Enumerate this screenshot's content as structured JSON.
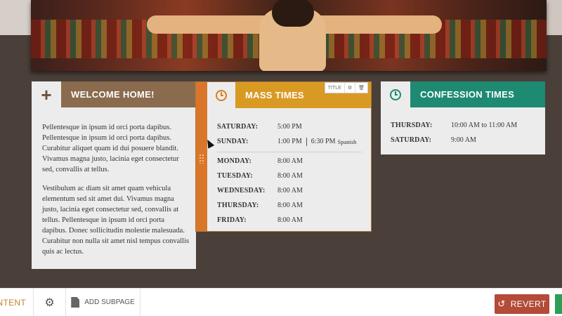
{
  "welcome": {
    "title": "WELCOME HOME!",
    "paragraphs": [
      "Pellentesque in ipsum id orci porta dapibus. Pellentesque in ipsum id orci porta dapibus. Curabitur aliquet quam id dui posuere blandit. Vivamus magna justo, lacinia eget consectetur sed, convallis at tellus.",
      "Vestibulum ac diam sit amet quam vehicula elementum sed sit amet dui. Vivamus magna justo, lacinia eget consectetur sed, convallis at tellus. Pellentesque in ipsum id orci porta dapibus. Donec sollicitudin molestie malesuada. Curabitur non nulla sit amet nisl tempus convallis quis ac lectus."
    ]
  },
  "mass": {
    "title": "MASS TIMES",
    "toolbar": {
      "title_label": "TITLE"
    },
    "weekend": [
      {
        "day": "SATURDAY:",
        "time": "5:00 PM"
      },
      {
        "day": "SUNDAY:",
        "time": "1:00 PM",
        "time2": "6:30 PM",
        "note": "Spanish"
      }
    ],
    "weekdays": [
      {
        "day": "MONDAY:",
        "time": "8:00 AM"
      },
      {
        "day": "TUESDAY:",
        "time": "8:00 AM"
      },
      {
        "day": "WEDNESDAY:",
        "time": "8:00 AM"
      },
      {
        "day": "THURSDAY:",
        "time": "8:00 AM"
      },
      {
        "day": "FRIDAY:",
        "time": "8:00 AM"
      }
    ]
  },
  "confession": {
    "title": "CONFESSION TIMES",
    "rows": [
      {
        "day": "THURSDAY:",
        "time": "10:00 AM to 11:00 AM"
      },
      {
        "day": "SATURDAY:",
        "time": "9:00 AM"
      }
    ]
  },
  "bottombar": {
    "content_label": "NTENT",
    "add_subpage_label": "ADD SUBPAGE",
    "revert_label": "REVERT"
  },
  "colors": {
    "welcome_header": "#8a6b4e",
    "mass_header": "#d99a24",
    "confession_header": "#1e8a72",
    "drag_handle": "#d9762a",
    "revert_button": "#b44a38",
    "publish_button": "#2e9d58"
  }
}
